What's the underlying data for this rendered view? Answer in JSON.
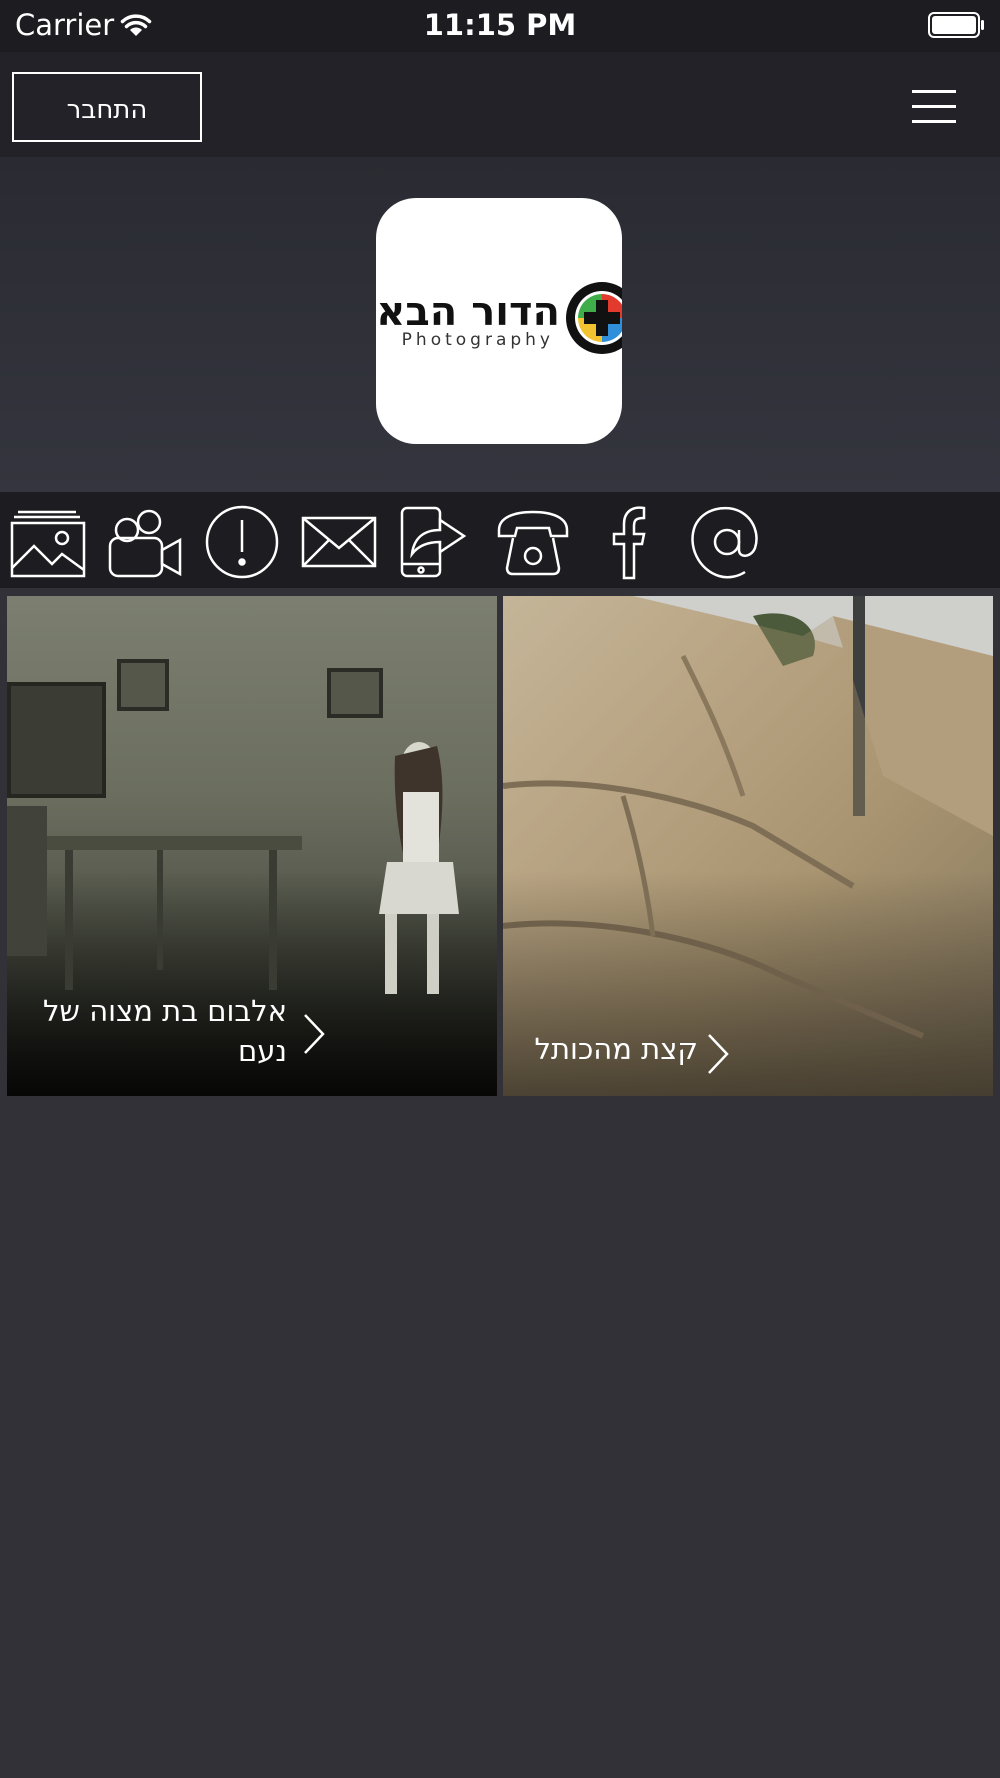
{
  "status_bar": {
    "carrier": "Carrier",
    "time": "11:15 PM",
    "icons": [
      "wifi-icon",
      "battery-icon"
    ]
  },
  "header": {
    "login_label": "התחבר",
    "menu_icon": "hamburger-menu-icon"
  },
  "hero": {
    "logo_text": "הדור הבא",
    "logo_subtext": "Photography",
    "logo_emblem_icon": "camera-lens-plus-icon"
  },
  "toolbar": {
    "icons": [
      "gallery-icon",
      "video-camera-icon",
      "info-icon",
      "mail-icon",
      "share-phone-icon",
      "phone-icon",
      "facebook-icon",
      "at-sign-icon"
    ]
  },
  "gallery": {
    "cards": [
      {
        "title": "אלבום בת מצוה של נעם"
      },
      {
        "title": "קצת מהכותל"
      }
    ]
  },
  "colors": {
    "background": "#313137",
    "header": "#222228",
    "toolbar": "#1d1d21",
    "text": "#ffffff"
  }
}
